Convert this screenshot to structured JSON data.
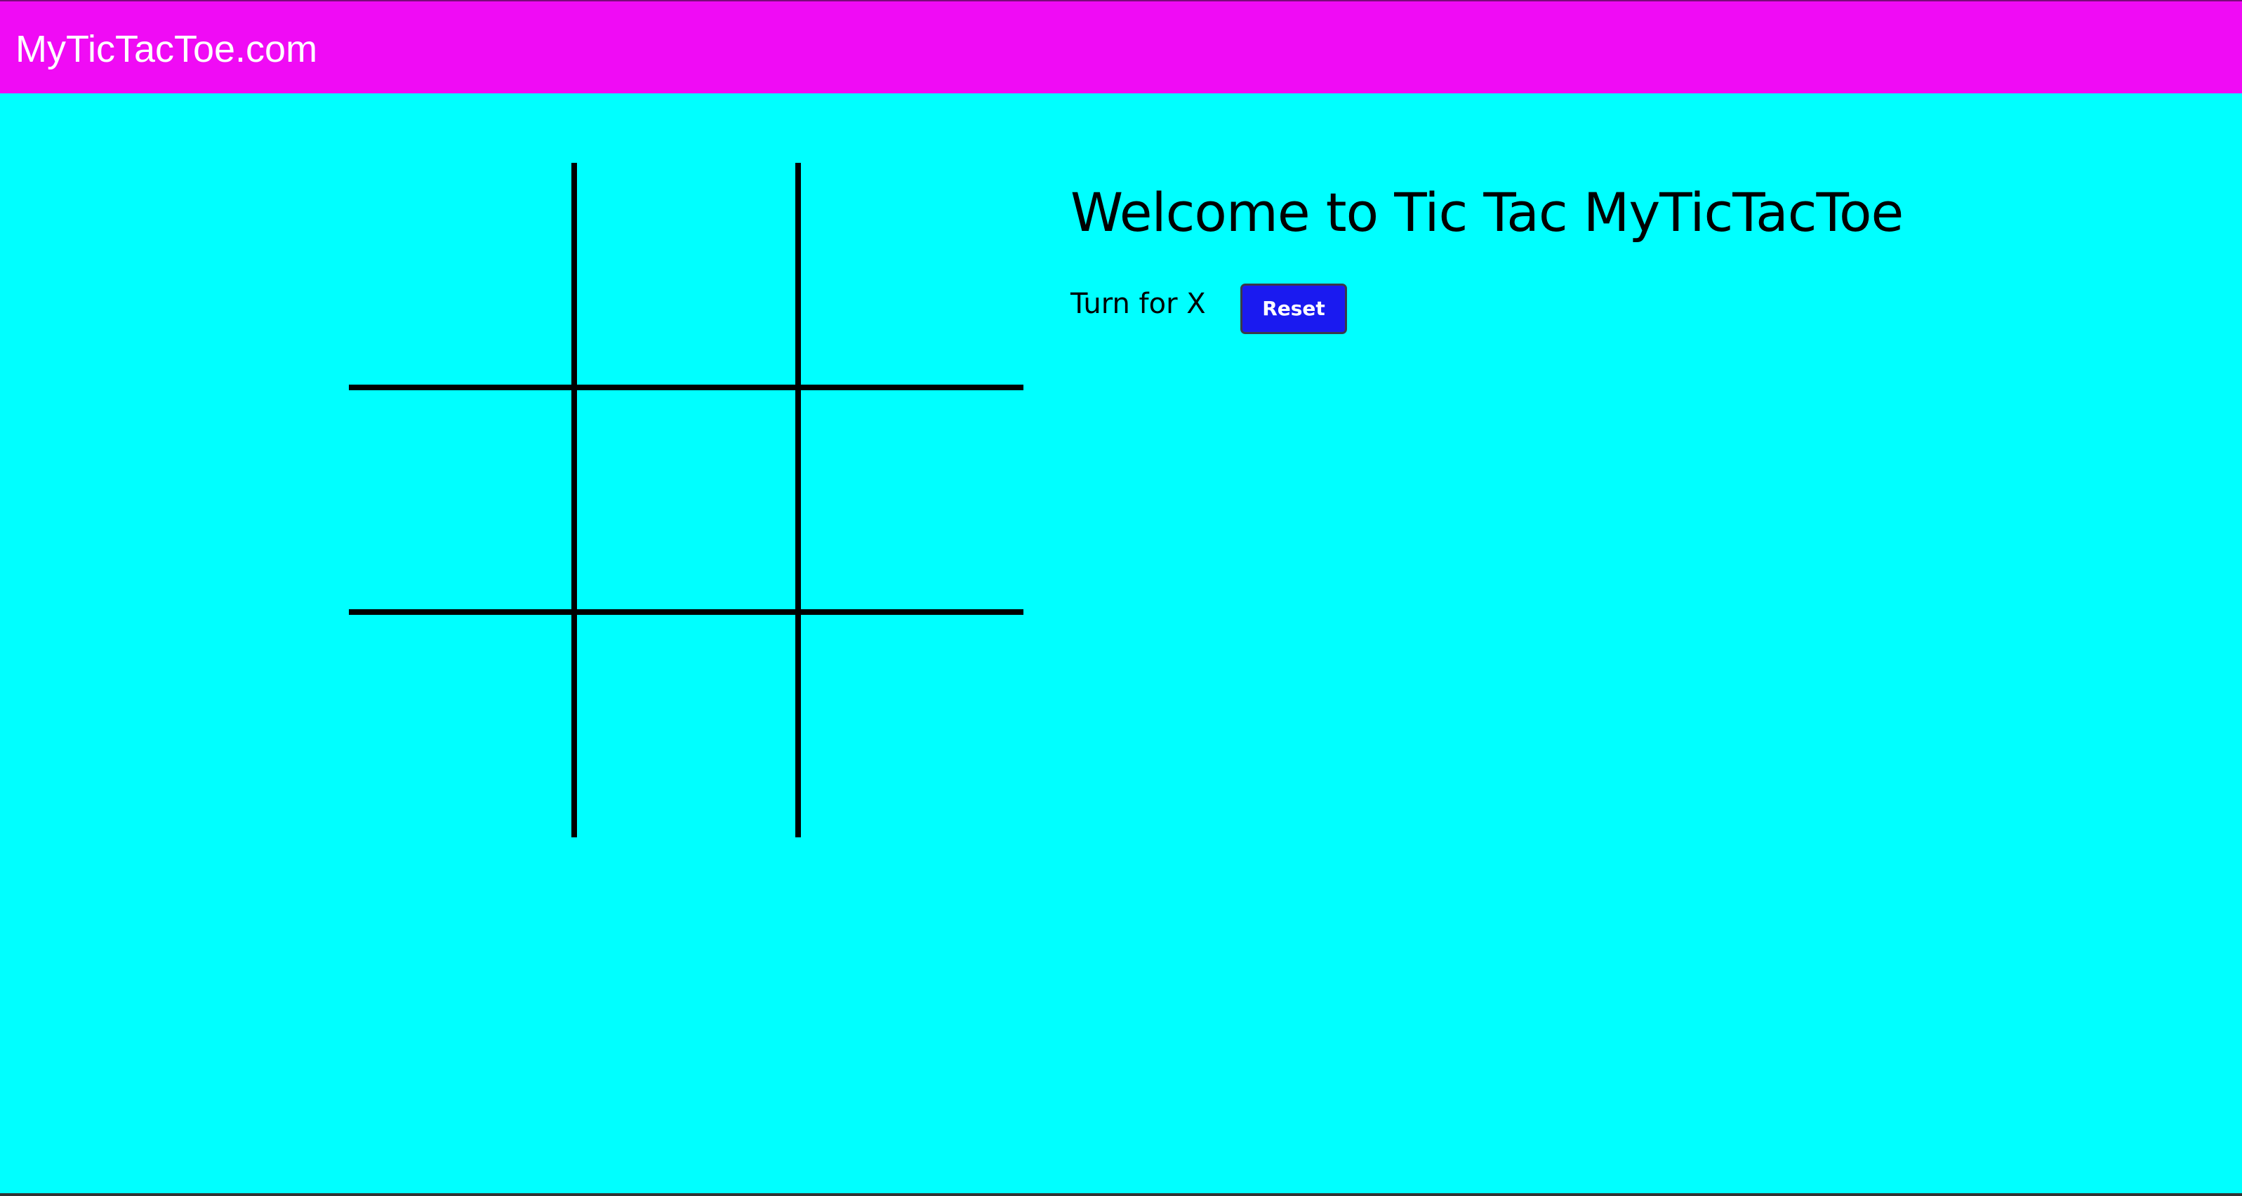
{
  "header": {
    "brand": "MyTicTacToe.com"
  },
  "board": {
    "cells": [
      "",
      "",
      "",
      "",
      "",
      "",
      "",
      "",
      ""
    ]
  },
  "main": {
    "heading": "Welcome to Tic Tac MyTicTacToe",
    "turn_text": "Turn for X",
    "reset_label": "Reset"
  },
  "colors": {
    "header_bg": "#F00BF5",
    "page_bg": "#00FFFF",
    "button_bg": "#1A1AF0",
    "grid_line": "#000000"
  }
}
